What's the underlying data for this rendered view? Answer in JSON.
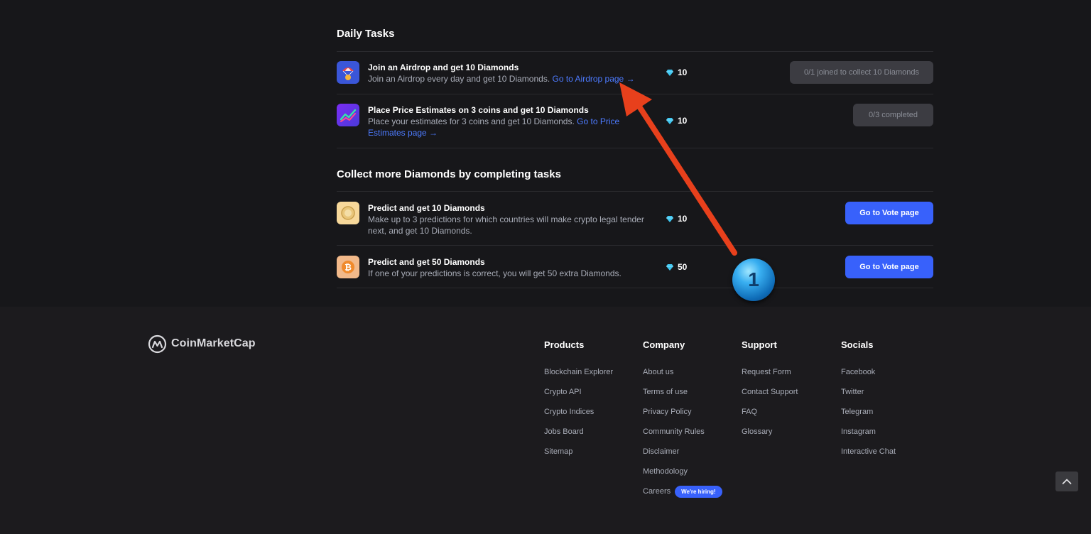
{
  "daily": {
    "title": "Daily Tasks",
    "tasks": [
      {
        "title": "Join an Airdrop and get 10 Diamonds",
        "desc": "Join an Airdrop every day and get 10 Diamonds.",
        "link": "Go to Airdrop page →",
        "reward": "10",
        "status": "0/1 joined to collect 10 Diamonds",
        "icon": "airdrop-icon"
      },
      {
        "title": "Place Price Estimates on 3 coins and get 10 Diamonds",
        "desc": "Place your estimates for 3 coins and get 10 Diamonds.",
        "link": "Go to Price Estimates page →",
        "reward": "10",
        "status": "0/3 completed",
        "icon": "price-estimate-icon"
      }
    ]
  },
  "collect": {
    "title": "Collect more Diamonds by completing tasks",
    "tasks": [
      {
        "title": "Predict and get 10 Diamonds",
        "desc": "Make up to 3 predictions for which countries will make crypto legal tender next, and get 10 Diamonds.",
        "reward": "10",
        "button": "Go to Vote page",
        "icon": "coin-icon"
      },
      {
        "title": "Predict and get 50 Diamonds",
        "desc": "If one of your predictions is correct, you will get 50 extra Diamonds.",
        "reward": "50",
        "button": "Go to Vote page",
        "icon": "bitcoin-icon"
      }
    ]
  },
  "footer": {
    "brand": "CoinMarketCap",
    "columns": [
      {
        "title": "Products",
        "links": [
          "Blockchain Explorer",
          "Crypto API",
          "Crypto Indices",
          "Jobs Board",
          "Sitemap"
        ]
      },
      {
        "title": "Company",
        "links": [
          "About us",
          "Terms of use",
          "Privacy Policy",
          "Community Rules",
          "Disclaimer",
          "Methodology",
          "Careers"
        ]
      },
      {
        "title": "Support",
        "links": [
          "Request Form",
          "Contact Support",
          "FAQ",
          "Glossary"
        ]
      },
      {
        "title": "Socials",
        "links": [
          "Facebook",
          "Twitter",
          "Telegram",
          "Instagram",
          "Interactive Chat"
        ]
      }
    ],
    "hiring_badge": "We're hiring!"
  },
  "annotation": {
    "step": "1"
  },
  "colors": {
    "background": "#17171a",
    "accent": "#3861fb",
    "link": "#4d7bff",
    "annotation_arrow": "#e8401c"
  }
}
